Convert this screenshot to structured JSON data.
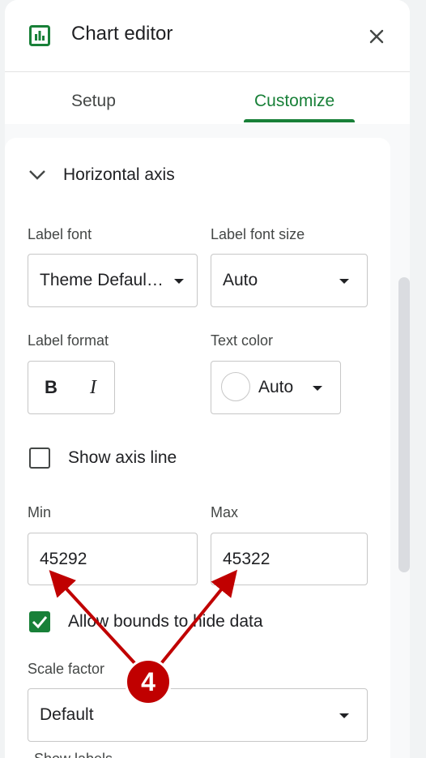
{
  "header": {
    "title": "Chart editor",
    "close_icon": "close-icon",
    "chart_icon": "bar-chart-icon",
    "accent": "#188038"
  },
  "tabs": [
    {
      "label": "Setup",
      "active": false
    },
    {
      "label": "Customize",
      "active": true
    }
  ],
  "section": {
    "title": "Horizontal axis",
    "expanded": true
  },
  "label_font": {
    "label": "Label font",
    "value": "Theme Defaul…"
  },
  "label_font_size": {
    "label": "Label font size",
    "value": "Auto"
  },
  "label_format": {
    "label": "Label format",
    "bold": "B",
    "italic": "I"
  },
  "text_color": {
    "label": "Text color",
    "value": "Auto",
    "swatch": "#ffffff"
  },
  "show_axis_line": {
    "label": "Show axis line",
    "checked": false
  },
  "min": {
    "label": "Min",
    "value": "45292"
  },
  "max": {
    "label": "Max",
    "value": "45322"
  },
  "allow_bounds": {
    "label": "Allow bounds to hide data",
    "checked": true
  },
  "scale_factor": {
    "label": "Scale factor",
    "value": "Default"
  },
  "next_label": "Show labels",
  "annotation": {
    "number": "4",
    "color": "#c00000"
  }
}
